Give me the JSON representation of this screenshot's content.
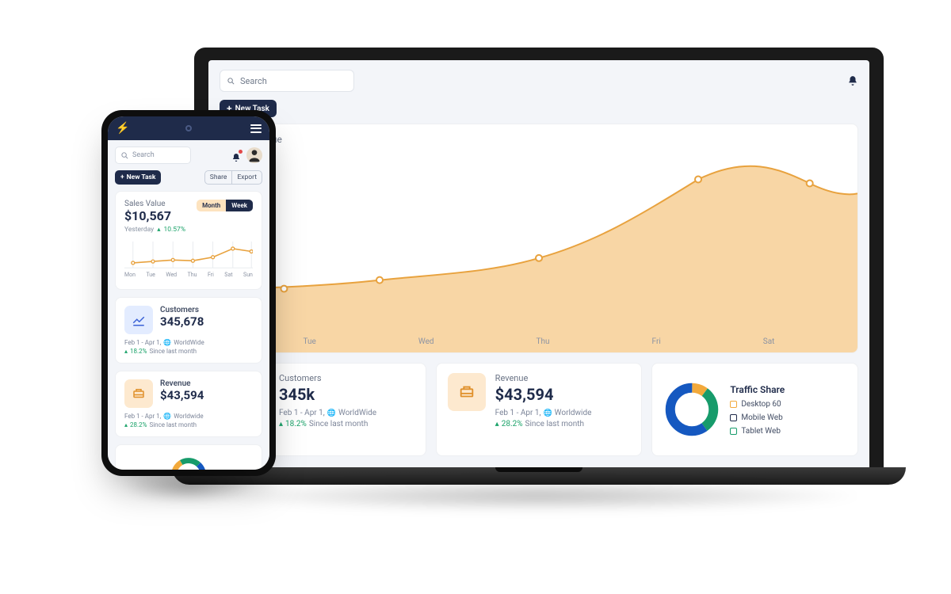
{
  "search": {
    "placeholder": "Search"
  },
  "buttons": {
    "new_task": "New Task",
    "share": "Share",
    "export": "Export",
    "month": "Month",
    "week": "Week"
  },
  "laptop": {
    "chart_title": "Sales Value",
    "axis": [
      "Tue",
      "Wed",
      "Thu",
      "Fri",
      "Sat"
    ],
    "customers": {
      "label": "Customers",
      "value": "345k",
      "range": "Feb 1 - Apr 1,",
      "scope": "WorldWide",
      "delta": "18.2%",
      "since": "Since last month"
    },
    "revenue": {
      "label": "Revenue",
      "value": "$43,594",
      "range": "Feb 1 - Apr 1,",
      "scope": "Worldwide",
      "delta": "28.2%",
      "since": "Since last month"
    },
    "traffic": {
      "label": "Traffic Share",
      "items": [
        "Desktop 60",
        "Mobile Web",
        "Tablet Web"
      ]
    }
  },
  "phone": {
    "sales": {
      "label": "Sales Value",
      "value": "$10,567",
      "yesterday": "Yesterday",
      "pct": "10.57%"
    },
    "mini_axis": [
      "Mon",
      "Tue",
      "Wed",
      "Thu",
      "Fri",
      "Sat",
      "Sun"
    ],
    "customers": {
      "label": "Customers",
      "value": "345,678",
      "range": "Feb 1 - Apr 1,",
      "scope": "WorldWide",
      "delta": "18.2%",
      "since": "Since last month"
    },
    "revenue": {
      "label": "Revenue",
      "value": "$43,594",
      "range": "Feb 1 - Apr 1,",
      "scope": "Worldwide",
      "delta": "28.2%",
      "since": "Since last month"
    }
  },
  "chart_data": [
    {
      "type": "area",
      "device": "laptop",
      "title": "Sales Value",
      "categories": [
        "Mon",
        "Tue",
        "Wed",
        "Thu",
        "Fri",
        "Sat",
        "Sun"
      ],
      "values": [
        28,
        30,
        35,
        38,
        52,
        78,
        72
      ],
      "ylim": [
        0,
        100
      ]
    },
    {
      "type": "line",
      "device": "phone",
      "title": "Sales Value",
      "categories": [
        "Mon",
        "Tue",
        "Wed",
        "Thu",
        "Fri",
        "Sat",
        "Sun"
      ],
      "values": [
        10,
        12,
        14,
        13,
        16,
        22,
        20
      ],
      "ylim": [
        0,
        30
      ]
    },
    {
      "type": "pie",
      "device": "both",
      "title": "Traffic Share",
      "series": [
        {
          "name": "Desktop",
          "value": 60,
          "color": "#1558c0"
        },
        {
          "name": "Mobile Web",
          "value": 30,
          "color": "#179b6b"
        },
        {
          "name": "Tablet Web",
          "value": 10,
          "color": "#f2a93b"
        }
      ]
    }
  ]
}
